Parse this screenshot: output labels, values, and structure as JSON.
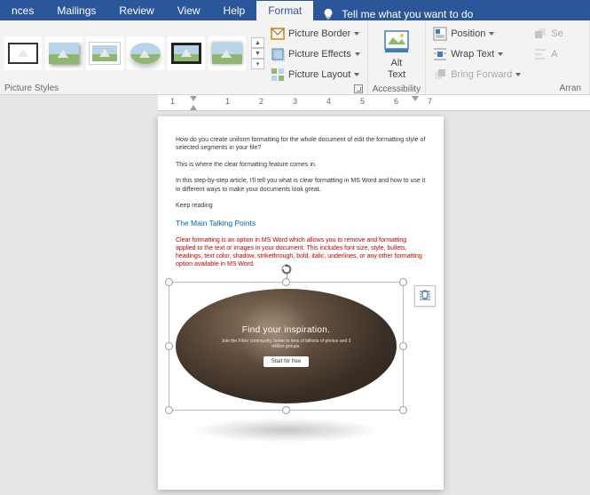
{
  "tabs": {
    "references_partial": "nces",
    "mailings": "Mailings",
    "review": "Review",
    "view": "View",
    "help": "Help",
    "format": "Format"
  },
  "tellme": {
    "placeholder": "Tell me what you want to do"
  },
  "ribbon": {
    "picture_border": "Picture Border",
    "picture_effects": "Picture Effects",
    "picture_layout": "Picture Layout",
    "alt_text": "Alt Text",
    "position": "Position",
    "wrap_text": "Wrap Text",
    "bring_forward": "Bring Forward",
    "align_partial": "A",
    "send_partial": "Se"
  },
  "groups": {
    "picture_styles": "Picture Styles",
    "accessibility": "Accessibility",
    "arrange_partial": "Arran"
  },
  "ruler": {
    "marks": [
      "1",
      "1",
      "2",
      "3",
      "4",
      "5",
      "6",
      "7"
    ]
  },
  "document": {
    "p1": "How do you create uniform formatting for the whole document of edit the formatting style of selected segments in your file?",
    "p2": "This is where the clear formatting feature comes in.",
    "p3": "In this step-by-step article, I'll tell you what is clear formatting in MS Word and how to use it in different ways to make your documents look great.",
    "p4": "Keep reading",
    "heading": "The Main Talking Points",
    "red_text": "Clear formatting is an option in MS Word which allows you to remove and formatting applied to the text or images in your document. This includes font size, style, bullets, headings, text color, shadow, strikethrough, bold, italic, underlines, or any other formatting option available in MS Word.",
    "image_title": "Find your inspiration.",
    "image_sub": "Join the Flickr community, home to tens of billions of photos and 2 million groups.",
    "image_button": "Start for free"
  }
}
